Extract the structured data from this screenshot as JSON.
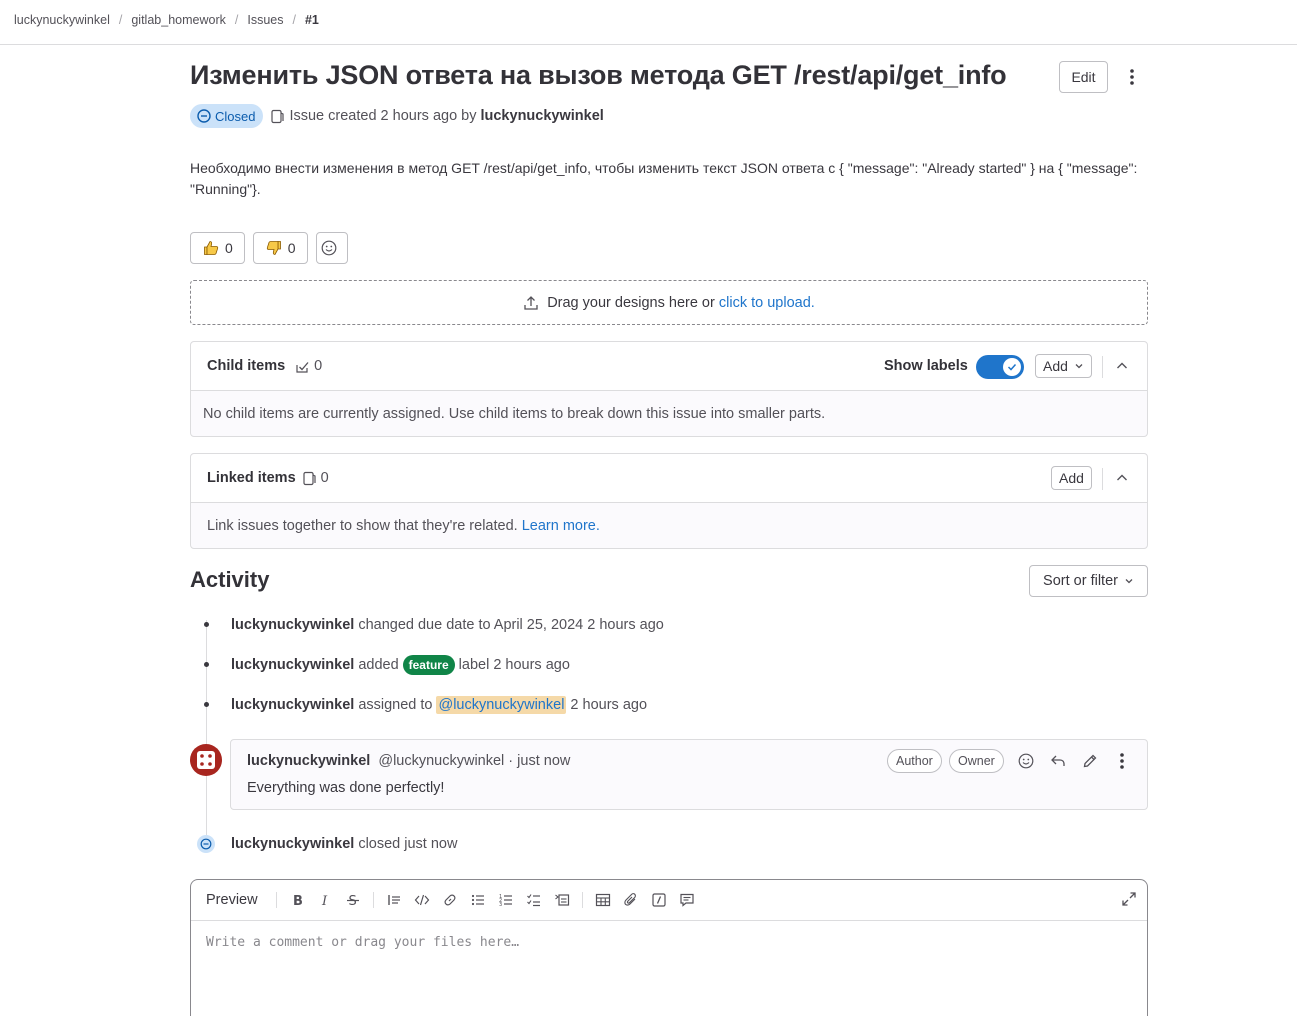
{
  "breadcrumb": {
    "items": [
      "luckynuckywinkel",
      "gitlab_homework",
      "Issues"
    ],
    "current": "#1",
    "separator": "/"
  },
  "issue": {
    "title": "Изменить JSON ответа на вызов метода GET /rest/api/get_info",
    "edit_label": "Edit",
    "status": "Closed",
    "created_text": "Issue created 2 hours ago by",
    "author": "luckynuckywinkel",
    "description": "Необходимо внести изменения в метод GET /rest/api/get_info, чтобы изменить текст JSON ответа с { \"message\": \"Already started\" } на { \"message\": \"Running\"}."
  },
  "reactions": {
    "thumbs_up": "0",
    "thumbs_down": "0"
  },
  "dropzone": {
    "text": "Drag your designs here or",
    "link": "click to upload",
    "suffix": "."
  },
  "child_items": {
    "title": "Child items",
    "count": "0",
    "show_labels": "Show labels",
    "add_label": "Add",
    "empty_text": "No child items are currently assigned. Use child items to break down this issue into smaller parts."
  },
  "linked_items": {
    "title": "Linked items",
    "count": "0",
    "add_label": "Add",
    "empty_text": "Link issues together to show that they're related.",
    "learn_more": "Learn more."
  },
  "activity": {
    "title": "Activity",
    "sort_label": "Sort or filter",
    "notes": [
      {
        "user": "luckynuckywinkel",
        "text": "changed due date to April 25, 2024 2 hours ago"
      },
      {
        "user": "luckynuckywinkel",
        "pre": "added",
        "label": "feature",
        "post": "label 2 hours ago"
      },
      {
        "user": "luckynuckywinkel",
        "pre": "assigned to",
        "mention": "@luckynuckywinkel",
        "post": "2 hours ago"
      }
    ],
    "comment": {
      "user": "luckynuckywinkel",
      "meta": "@luckynuckywinkel · just now",
      "badge_author": "Author",
      "badge_owner": "Owner",
      "body": "Everything was done perfectly!"
    },
    "closed_note": {
      "user": "luckynuckywinkel",
      "text": "closed just now"
    }
  },
  "editor": {
    "preview_label": "Preview",
    "placeholder": "Write a comment or drag your files here…"
  },
  "colors": {
    "accent": "#1f75cb",
    "closed_badge_bg": "#cbe2f9",
    "label_feature": "#108548",
    "avatar": "#a8261f"
  }
}
